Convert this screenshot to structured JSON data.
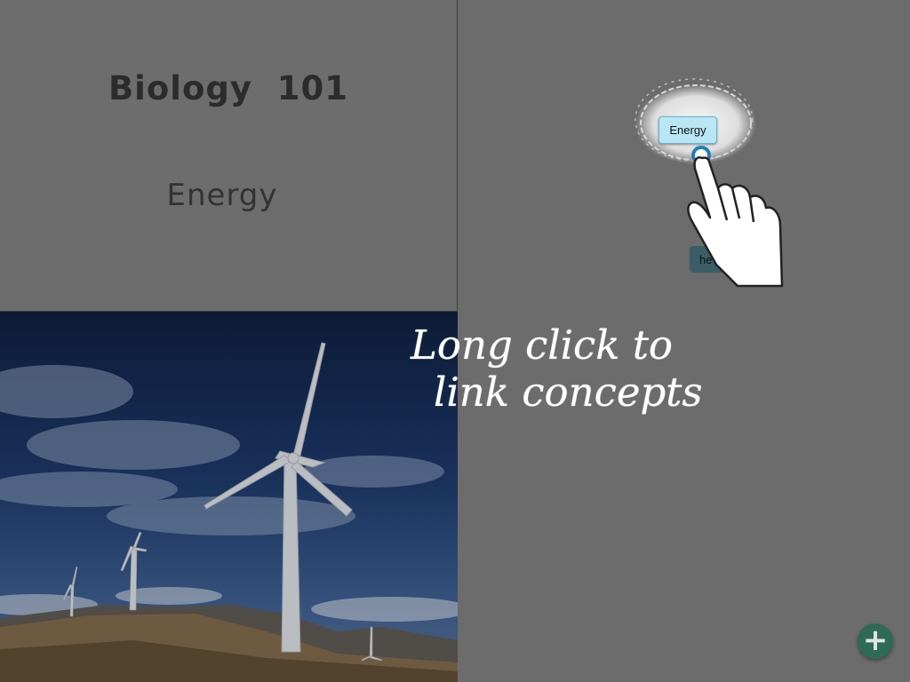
{
  "card": {
    "title": "Biology  101",
    "concept": "Energy"
  },
  "photo": {
    "subject": "wind-turbines",
    "sky_color": "#1c3766"
  },
  "concept_map": {
    "nodes": [
      {
        "label": "Energy",
        "state": "highlighted"
      },
      {
        "label": "he",
        "state": "partially-hidden"
      }
    ]
  },
  "tutorial": {
    "line1": "Long click to",
    "line2": "link concepts",
    "gesture_icon": "pointing-hand-icon"
  },
  "fab": {
    "icon": "plus-icon",
    "glyph": "+",
    "color": "#2d6b57"
  }
}
